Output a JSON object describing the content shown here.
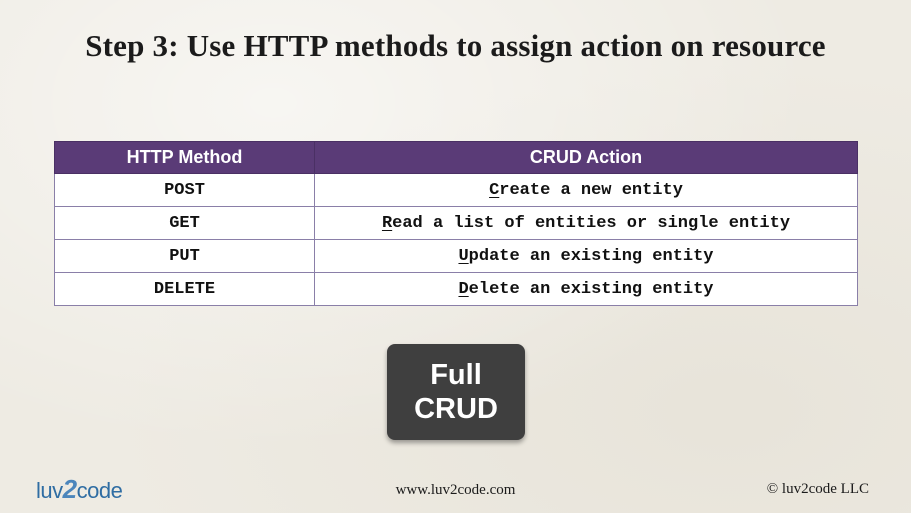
{
  "slide": {
    "title": "Step 3: Use HTTP methods to assign action on resource"
  },
  "table": {
    "headers": [
      "HTTP Method",
      "CRUD Action"
    ],
    "rows": [
      {
        "method": "POST",
        "action_initial": "C",
        "action_rest": "reate a new entity"
      },
      {
        "method": "GET",
        "action_initial": "R",
        "action_rest": "ead a list of entities or single entity"
      },
      {
        "method": "PUT",
        "action_initial": "U",
        "action_rest": "pdate an existing entity"
      },
      {
        "method": "DELETE",
        "action_initial": "D",
        "action_rest": "elete an existing entity"
      }
    ]
  },
  "badge": {
    "line1": "Full",
    "line2": "CRUD"
  },
  "footer": {
    "logo_part1": "luv",
    "logo_part2": "2",
    "logo_part3": "code",
    "url": "www.luv2code.com",
    "copyright": "© luv2code LLC"
  },
  "colors": {
    "header_bg": "#5a3b77",
    "badge_bg": "#3f3f3f",
    "logo_blue": "#2f6da3"
  }
}
